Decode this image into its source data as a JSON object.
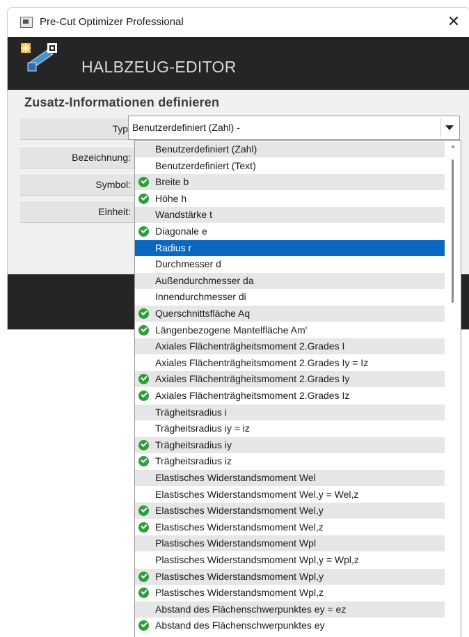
{
  "window": {
    "title": "Pre-Cut Optimizer Professional",
    "close_glyph": "✕"
  },
  "banner": {
    "title": "HALBZEUG-EDITOR"
  },
  "section": {
    "title": "Zusatz-Informationen definieren"
  },
  "fields": {
    "typ_label": "Typ:",
    "bezeichnung_label": "Bezeichnung:",
    "symbol_label": "Symbol:",
    "einheit_label": "Einheit:"
  },
  "combo": {
    "value": "Benutzerdefiniert (Zahl) -"
  },
  "dropdown": {
    "items": [
      {
        "label": "Benutzerdefiniert (Zahl)",
        "checked": false,
        "selected": false
      },
      {
        "label": "Benutzerdefiniert (Text)",
        "checked": false,
        "selected": false
      },
      {
        "label": "Breite b",
        "checked": true,
        "selected": false
      },
      {
        "label": "Höhe h",
        "checked": true,
        "selected": false
      },
      {
        "label": "Wandstärke t",
        "checked": false,
        "selected": false
      },
      {
        "label": "Diagonale e",
        "checked": true,
        "selected": false
      },
      {
        "label": "Radius r",
        "checked": false,
        "selected": true
      },
      {
        "label": "Durchmesser d",
        "checked": false,
        "selected": false
      },
      {
        "label": "Außendurchmesser da",
        "checked": false,
        "selected": false
      },
      {
        "label": "Innendurchmesser di",
        "checked": false,
        "selected": false
      },
      {
        "label": "Querschnittsfläche Aq",
        "checked": true,
        "selected": false
      },
      {
        "label": "Längenbezogene Mantelfläche Am'",
        "checked": true,
        "selected": false
      },
      {
        "label": "Axiales Flächenträgheitsmoment 2.Grades I",
        "checked": false,
        "selected": false
      },
      {
        "label": "Axiales Flächenträgheitsmoment 2.Grades Iy = Iz",
        "checked": false,
        "selected": false
      },
      {
        "label": "Axiales Flächenträgheitsmoment 2.Grades Iy",
        "checked": true,
        "selected": false
      },
      {
        "label": "Axiales Flächenträgheitsmoment 2.Grades Iz",
        "checked": true,
        "selected": false
      },
      {
        "label": "Trägheitsradius i",
        "checked": false,
        "selected": false
      },
      {
        "label": "Trägheitsradius iy = iz",
        "checked": false,
        "selected": false
      },
      {
        "label": "Trägheitsradius iy",
        "checked": true,
        "selected": false
      },
      {
        "label": "Trägheitsradius iz",
        "checked": true,
        "selected": false
      },
      {
        "label": "Elastisches Widerstandsmoment Wel",
        "checked": false,
        "selected": false
      },
      {
        "label": "Elastisches Widerstandsmoment Wel,y = Wel,z",
        "checked": false,
        "selected": false
      },
      {
        "label": "Elastisches Widerstandsmoment Wel,y",
        "checked": true,
        "selected": false
      },
      {
        "label": "Elastisches Widerstandsmoment Wel,z",
        "checked": true,
        "selected": false
      },
      {
        "label": "Plastisches Widerstandsmoment Wpl",
        "checked": false,
        "selected": false
      },
      {
        "label": "Plastisches Widerstandsmoment Wpl,y = Wpl,z",
        "checked": false,
        "selected": false
      },
      {
        "label": "Plastisches Widerstandsmoment Wpl,y",
        "checked": true,
        "selected": false
      },
      {
        "label": "Plastisches Widerstandsmoment Wpl,z",
        "checked": true,
        "selected": false
      },
      {
        "label": "Abstand des Flächenschwerpunktes ey = ez",
        "checked": false,
        "selected": false
      },
      {
        "label": "Abstand des Flächenschwerpunktes ey",
        "checked": true,
        "selected": false
      }
    ]
  },
  "colors": {
    "selection": "#0a67c2",
    "check": "#2e9e3a",
    "banner": "#252525"
  }
}
